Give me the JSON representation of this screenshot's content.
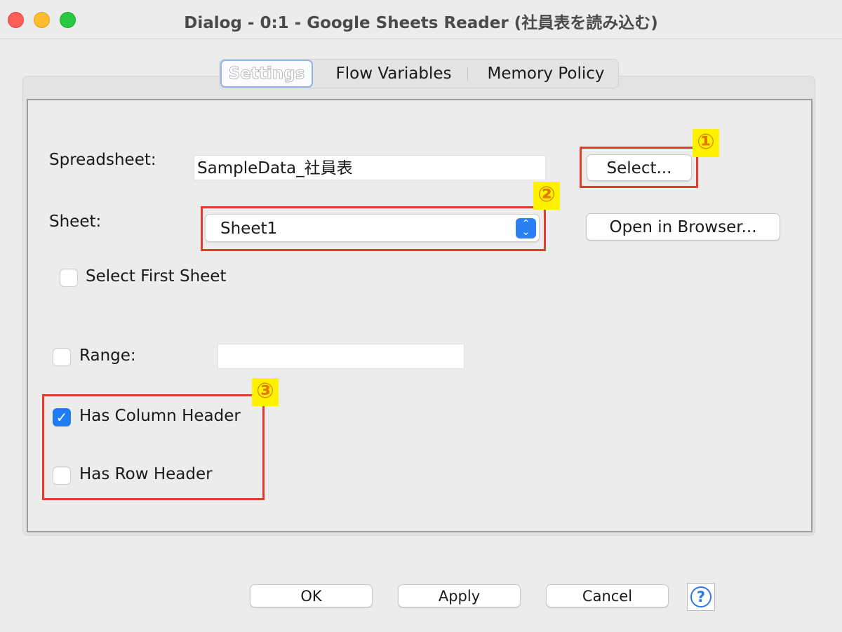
{
  "window": {
    "title": "Dialog - 0:1 - Google Sheets Reader (社員表を読み込む)"
  },
  "tabs": [
    {
      "label": "Settings",
      "selected": true
    },
    {
      "label": "Flow Variables",
      "selected": false
    },
    {
      "label": "Memory Policy",
      "selected": false
    }
  ],
  "settings": {
    "spreadsheet_label": "Spreadsheet:",
    "spreadsheet_value": "SampleData_社員表",
    "select_button": "Select...",
    "sheet_label": "Sheet:",
    "sheet_value": "Sheet1",
    "open_browser_button": "Open in Browser...",
    "select_first_sheet_label": "Select First Sheet",
    "select_first_sheet_checked": false,
    "range_label": "Range:",
    "range_checked": false,
    "range_value": "",
    "has_column_header_label": "Has Column Header",
    "has_column_header_checked": true,
    "has_row_header_label": "Has Row Header",
    "has_row_header_checked": false
  },
  "annotations": [
    "①",
    "②",
    "③"
  ],
  "footer": {
    "ok": "OK",
    "apply": "Apply",
    "cancel": "Cancel",
    "help_icon": "?"
  },
  "colors": {
    "annotation_border": "#e33b2c",
    "annotation_badge_bg": "#fff200",
    "annotation_badge_text": "#e07a00",
    "checkbox_checked": "#1f7cf2",
    "select_arrow": "#2a7ff4"
  }
}
